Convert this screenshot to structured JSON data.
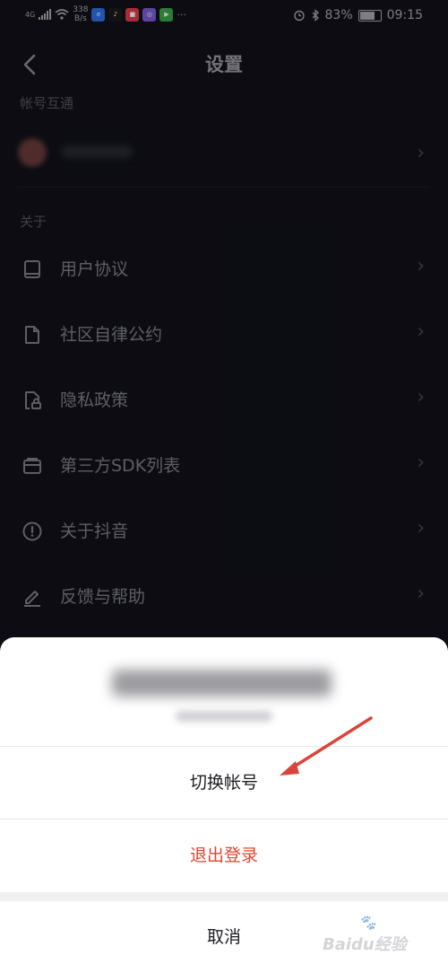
{
  "status_bar": {
    "network": "4G",
    "speed_value": "338",
    "speed_unit": "B/s",
    "app_icon_names": [
      "app-icon-1",
      "tiktok-icon",
      "app-icon-3",
      "app-icon-4",
      "play-icon"
    ],
    "more": "···",
    "battery": "83%",
    "battery_level": 0.83,
    "time": "09:15"
  },
  "header": {
    "title": "设置"
  },
  "account_section": {
    "label": "帐号互通"
  },
  "about_section": {
    "label": "关于",
    "items": [
      {
        "label": "用户协议",
        "icon": "book-icon"
      },
      {
        "label": "社区自律公约",
        "icon": "document-icon"
      },
      {
        "label": "隐私政策",
        "icon": "lock-document-icon"
      },
      {
        "label": "第三方SDK列表",
        "icon": "card-icon"
      },
      {
        "label": "关于抖音",
        "icon": "info-icon"
      },
      {
        "label": "反馈与帮助",
        "icon": "edit-icon"
      }
    ]
  },
  "sheet": {
    "switch_label": "切换帐号",
    "logout_label": "退出登录",
    "cancel_label": "取消"
  },
  "watermark": {
    "text": "Baidu经验"
  },
  "colors": {
    "page_bg": "#101118",
    "sheet_bg": "#ffffff",
    "logout_red": "#e0452f",
    "arrow_red": "#d9453a"
  }
}
